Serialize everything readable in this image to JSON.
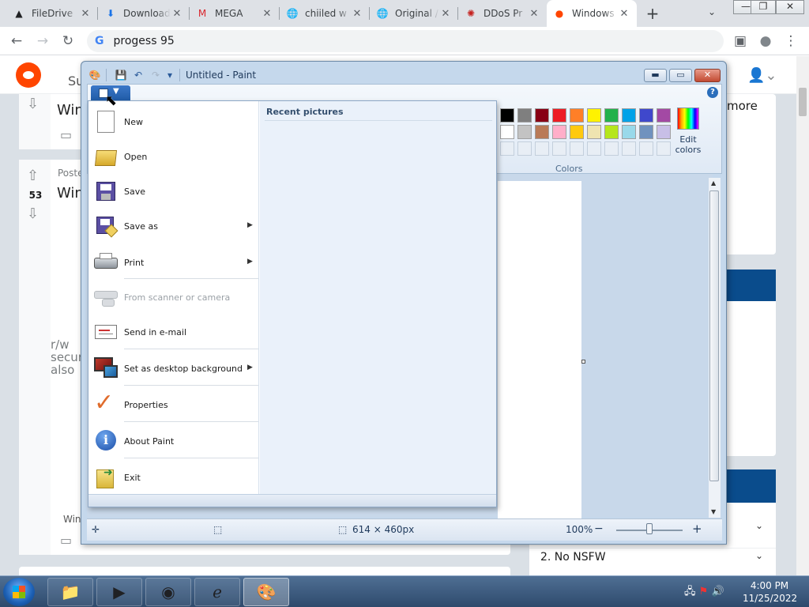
{
  "browser": {
    "tabs": [
      {
        "title": "FileDrive",
        "icon": "drive-warning-icon",
        "glyph": "▲",
        "color": "#202124"
      },
      {
        "title": "Download",
        "icon": "download-icon",
        "glyph": "⬇",
        "color": "#1a73e8"
      },
      {
        "title": "MEGA",
        "icon": "mega-icon",
        "glyph": "M",
        "color": "#d9272e"
      },
      {
        "title": "chiiled w",
        "icon": "globe-icon",
        "glyph": "🌐",
        "color": "#5f6368"
      },
      {
        "title": "Original /",
        "icon": "globe-icon",
        "glyph": "🌐",
        "color": "#5f6368"
      },
      {
        "title": "DDoS Pr",
        "icon": "ddos-icon",
        "glyph": "✺",
        "color": "#c5221f"
      },
      {
        "title": "Windows",
        "icon": "reddit-icon",
        "glyph": "●",
        "color": "#ff4500",
        "active": true
      }
    ],
    "new_tab": "+",
    "tab_list": "⌄",
    "window_controls": {
      "minimize": "—",
      "restore": "❐",
      "close": "✕"
    },
    "address": "progess 95",
    "nav": {
      "back": "←",
      "forward": "→",
      "reload": "↻"
    },
    "right_icons": {
      "side_panel": "▣",
      "profile": "●",
      "menu": "⋮"
    }
  },
  "reddit": {
    "post1_title": "Win",
    "post2_meta": "Poste",
    "post2_votes": "53",
    "post2_title": "Win",
    "broken_image_alt": "r/w secur also",
    "footer_text": "Win",
    "side_more": "more",
    "rule_2": "2. No NSFW",
    "logo_label": "Su"
  },
  "paint": {
    "title": "Untitled - Paint",
    "qat": {
      "save": "💾",
      "undo": "↶",
      "redo": "↷",
      "customize": "▾"
    },
    "window_buttons": {
      "minimize": "▬",
      "maximize": "▭",
      "close": "✕"
    },
    "help": "?",
    "colors_label": "Colors",
    "edit_colors": "Edit colors",
    "palette_row1": [
      "#000000",
      "#7f7f7f",
      "#880015",
      "#ed1c24",
      "#ff7f27",
      "#fff200",
      "#22b14c",
      "#00a2e8",
      "#3f48cc",
      "#a349a4"
    ],
    "palette_row2": [
      "#ffffff",
      "#c3c3c3",
      "#b97a57",
      "#ffaec9",
      "#ffc90e",
      "#efe4b0",
      "#b5e61d",
      "#99d9ea",
      "#7092be",
      "#c8bfe7"
    ],
    "status": {
      "canvas_size": "614 × 460px",
      "zoom": "100%",
      "zoom_out": "−",
      "zoom_in": "+"
    },
    "file_menu": {
      "recent_label": "Recent pictures",
      "items": [
        {
          "label": "New",
          "icon": "new-file-icon"
        },
        {
          "label": "Open",
          "icon": "open-folder-icon"
        },
        {
          "label": "Save",
          "icon": "save-disk-icon"
        },
        {
          "label": "Save as",
          "icon": "save-as-icon",
          "submenu": true
        },
        {
          "label": "Print",
          "icon": "printer-icon",
          "submenu": true
        },
        {
          "label": "From scanner or camera",
          "icon": "scanner-icon",
          "disabled": true
        },
        {
          "label": "Send in e-mail",
          "icon": "email-icon"
        },
        {
          "label": "Set as desktop background",
          "icon": "desktop-background-icon",
          "submenu": true
        },
        {
          "label": "Properties",
          "icon": "checkmark-icon"
        },
        {
          "label": "About Paint",
          "icon": "info-icon"
        },
        {
          "label": "Exit",
          "icon": "exit-icon"
        }
      ]
    }
  },
  "taskbar": {
    "pinned": [
      "file-explorer-icon",
      "media-player-icon",
      "chrome-icon",
      "internet-explorer-icon",
      "paint-icon"
    ],
    "clock_time": "4:00 PM",
    "clock_date": "11/25/2022"
  }
}
